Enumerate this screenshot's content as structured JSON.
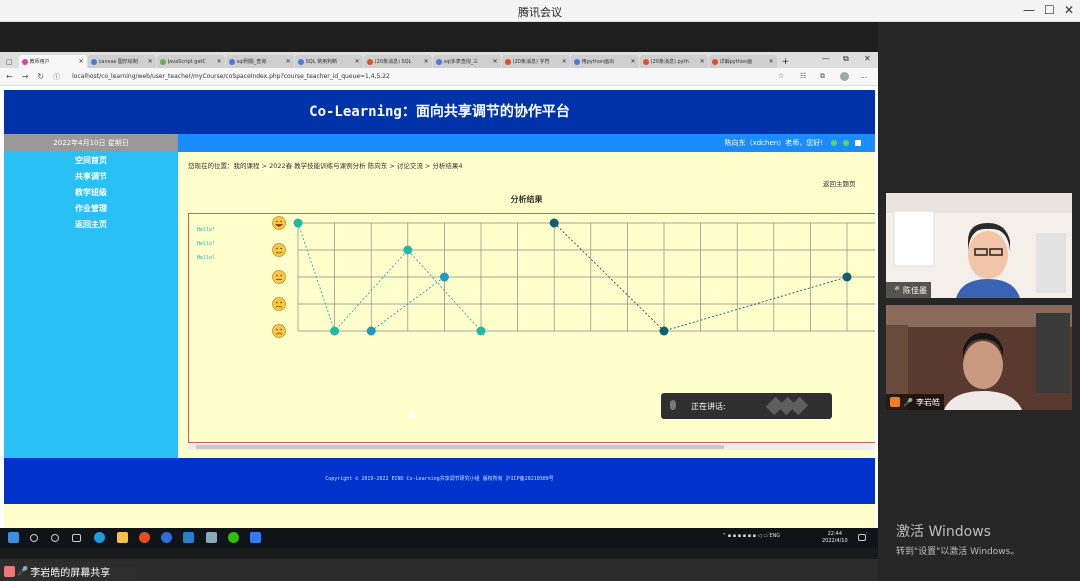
{
  "meeting": {
    "title": "腾讯会议",
    "share_label": "李岩皓的屏幕共享",
    "speaking_label": "正在讲话:",
    "participants": [
      {
        "name": "陈佳墨"
      },
      {
        "name": "李岩皓"
      }
    ],
    "activate_line1": "激活 Windows",
    "activate_line2": "转到\"设置\"以激活 Windows。"
  },
  "browser": {
    "tabs": [
      {
        "label": "教师用户",
        "color": "#e040a0",
        "active": true
      },
      {
        "label": "canvas 图形绘制",
        "color": "#4a7be0"
      },
      {
        "label": "JavaScript getC",
        "color": "#6ab04c"
      },
      {
        "label": "sql例题_查询",
        "color": "#4a7be0"
      },
      {
        "label": "SQL 常用判断",
        "color": "#4a7be0"
      },
      {
        "label": "(20条消息) SQL",
        "color": "#e05020"
      },
      {
        "label": "sql多表查询_三",
        "color": "#4a7be0"
      },
      {
        "label": "(20条消息) 字符",
        "color": "#e05020"
      },
      {
        "label": "用python画出",
        "color": "#4a7be0"
      },
      {
        "label": "(20条消息) pyth",
        "color": "#e05020"
      },
      {
        "label": "详解python画",
        "color": "#e05020"
      }
    ],
    "url": "localhost/co_learning/web/user_teacher/myCourse/coSpaceIndex.php?course_teacher_id_queue=1,4,5,22"
  },
  "page": {
    "banner": "Co-Learning：面向共享调节的协作平台",
    "date": "2022年4月10日 星期日",
    "greeting": "陈向东（xdchen）老师，您好!",
    "menu": [
      "空间首页",
      "共享调节",
      "教学班级",
      "作业管理",
      "返回主页"
    ],
    "breadcrumb": "您现在的位置：我的课程 > 2022春 教学技能训练与课例分析 陈向东 > 讨论交流 > 分析结果4",
    "back_link": "返回主题页",
    "footer": "Copyright © 2019-2022 ECNU Co-Learning共享调节研究小组 版权所有 沪ICP备20210309号"
  },
  "chart_data": {
    "type": "line",
    "title": "分析结果",
    "legend": [
      "Hello!",
      "Hello!",
      "Hello!"
    ],
    "y_levels": 5,
    "face_icons": [
      "laughing-face",
      "smiling-face",
      "neutral-face",
      "sweating-face",
      "angry-face"
    ],
    "series": [
      {
        "color": "#22b8a8",
        "points": [
          [
            0,
            4
          ],
          [
            1,
            0
          ],
          [
            3,
            3
          ],
          [
            5,
            0
          ]
        ]
      },
      {
        "color": "#1f9bbd",
        "points": [
          [
            2,
            0
          ],
          [
            4,
            2
          ]
        ]
      },
      {
        "color": "#0e5f72",
        "points": [
          [
            7,
            4
          ],
          [
            10,
            0
          ],
          [
            15,
            2
          ]
        ]
      }
    ]
  },
  "taskbar": {
    "tray": "ENG",
    "time": "22:44",
    "date": "2022/4/10"
  }
}
